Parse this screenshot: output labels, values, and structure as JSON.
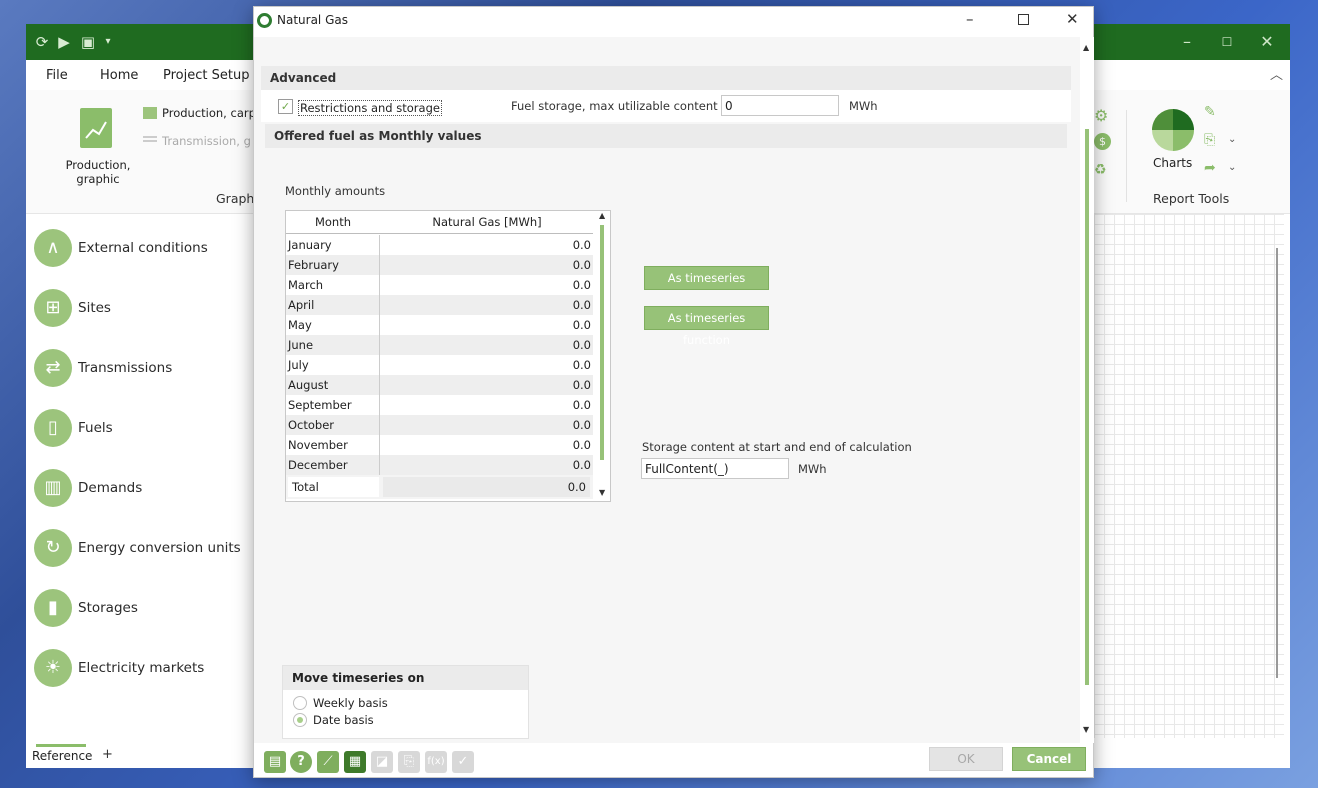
{
  "main_window": {
    "menu": [
      "File",
      "Home",
      "Project Setup"
    ],
    "ribbon": {
      "production_graphic_label": "Production, graphic",
      "production_item": "Production, carp",
      "transmission_item": "Transmission, g",
      "graph_group": "Graph",
      "charts_label": "Charts",
      "report_tools": "Report Tools"
    },
    "sidebar": [
      {
        "label": "External conditions",
        "icon": "chart-curve-icon"
      },
      {
        "label": "Sites",
        "icon": "sites-icon"
      },
      {
        "label": "Transmissions",
        "icon": "transmission-arrows-icon"
      },
      {
        "label": "Fuels",
        "icon": "fuel-pump-icon"
      },
      {
        "label": "Demands",
        "icon": "demands-chart-icon"
      },
      {
        "label": "Energy conversion units",
        "icon": "conversion-icon"
      },
      {
        "label": "Storages",
        "icon": "battery-icon"
      },
      {
        "label": "Electricity markets",
        "icon": "lightbulb-icon"
      }
    ],
    "bottom_tab": "Reference",
    "add_tab": "+"
  },
  "dialog": {
    "title": "Natural Gas",
    "advanced_header": "Advanced",
    "restrictions_label": "Restrictions and storage",
    "restrictions_checked": true,
    "fuel_storage_label": "Fuel storage, max utilizable content",
    "fuel_storage_value": "0",
    "fuel_storage_unit": "MWh",
    "offered_header": "Offered fuel as Monthly values",
    "monthly_amounts_label": "Monthly amounts",
    "table": {
      "col_month": "Month",
      "col_value": "Natural Gas [MWh]",
      "rows": [
        {
          "month": "January",
          "value": "0.0"
        },
        {
          "month": "February",
          "value": "0.0"
        },
        {
          "month": "March",
          "value": "0.0"
        },
        {
          "month": "April",
          "value": "0.0"
        },
        {
          "month": "May",
          "value": "0.0"
        },
        {
          "month": "June",
          "value": "0.0"
        },
        {
          "month": "July",
          "value": "0.0"
        },
        {
          "month": "August",
          "value": "0.0"
        },
        {
          "month": "September",
          "value": "0.0"
        },
        {
          "month": "October",
          "value": "0.0"
        },
        {
          "month": "November",
          "value": "0.0"
        },
        {
          "month": "December",
          "value": "0.0"
        }
      ],
      "total_label": "Total",
      "total_value": "0.0"
    },
    "btn_timeseries": "As timeseries",
    "btn_timeseries_function": "As timeseries function",
    "storage_content_label": "Storage content at start and end of calculation",
    "storage_content_value": "FullContent(_)",
    "storage_content_unit": "MWh",
    "move_header": "Move timeseries on",
    "radio_weekly": "Weekly basis",
    "radio_date": "Date basis",
    "selected_radio": "date",
    "ok_label": "OK",
    "cancel_label": "Cancel",
    "fx_label": "f(x)"
  },
  "colors": {
    "accent": "#97c278",
    "titlebar": "#1f6b20",
    "icon_green": "#9cc47c"
  }
}
